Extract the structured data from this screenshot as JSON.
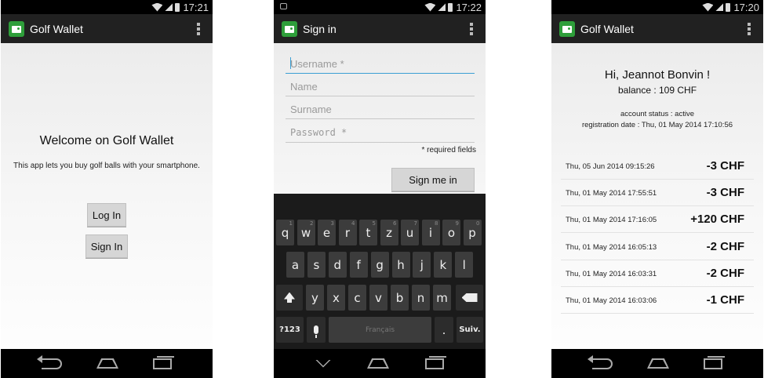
{
  "screens": {
    "welcome": {
      "time": "17:21",
      "app_title": "Golf Wallet",
      "welcome": "Welcome on Golf Wallet",
      "description": "This app lets you buy golf balls with your smartphone.",
      "login_label": "Log In",
      "signin_label": "Sign In"
    },
    "signin": {
      "time": "17:22",
      "title": "Sign in",
      "fields": {
        "username": "Username *",
        "name": "Name",
        "surname": "Surname",
        "password": "Password *"
      },
      "required_note": "* required fields",
      "submit_label": "Sign me in",
      "keyboard": {
        "row1": [
          {
            "k": "q",
            "s": "1"
          },
          {
            "k": "w",
            "s": "2"
          },
          {
            "k": "e",
            "s": "3"
          },
          {
            "k": "r",
            "s": "4"
          },
          {
            "k": "t",
            "s": "5"
          },
          {
            "k": "z",
            "s": "6"
          },
          {
            "k": "u",
            "s": "7"
          },
          {
            "k": "i",
            "s": "8"
          },
          {
            "k": "o",
            "s": "9"
          },
          {
            "k": "p",
            "s": "0"
          }
        ],
        "row2": [
          "a",
          "s",
          "d",
          "f",
          "g",
          "h",
          "j",
          "k",
          "l"
        ],
        "row3": [
          "y",
          "x",
          "c",
          "v",
          "b",
          "n",
          "m"
        ],
        "symbols_label": "?123",
        "space_label": "Français",
        "period_label": ".",
        "next_label": "Suiv."
      }
    },
    "account": {
      "time": "17:20",
      "app_title": "Golf Wallet",
      "greeting": "Hi, Jeannot Bonvin !",
      "balance": "balance : 109 CHF",
      "status": "account status : active",
      "registration": "registration date : Thu, 01 May 2014 17:10:56",
      "transactions": [
        {
          "date": "Thu, 05 Jun 2014 09:15:26",
          "amount": "-3 CHF"
        },
        {
          "date": "Thu, 01 May 2014 17:55:51",
          "amount": "-3 CHF"
        },
        {
          "date": "Thu, 01 May 2014 17:16:05",
          "amount": "+120 CHF"
        },
        {
          "date": "Thu, 01 May 2014 16:05:13",
          "amount": "-2 CHF"
        },
        {
          "date": "Thu, 01 May 2014 16:03:31",
          "amount": "-2 CHF"
        },
        {
          "date": "Thu, 01 May 2014 16:03:06",
          "amount": "-1 CHF"
        }
      ]
    }
  }
}
